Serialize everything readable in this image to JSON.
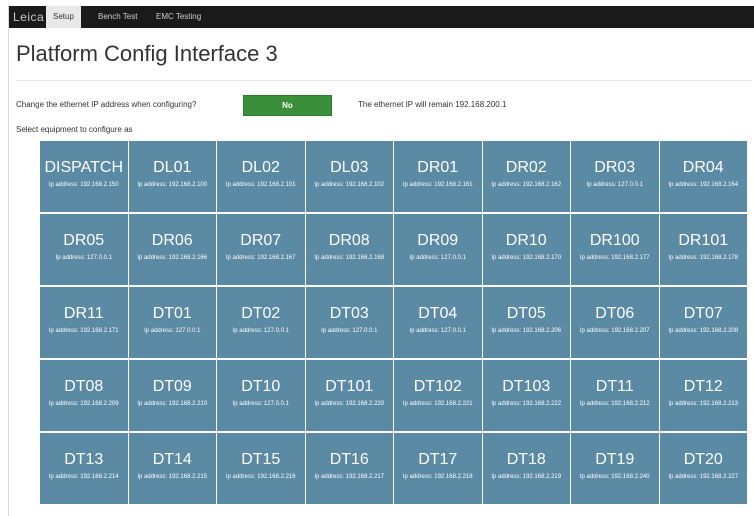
{
  "navbar": {
    "brand": "Leica",
    "tabs": [
      {
        "label": "Setup",
        "active": true
      },
      {
        "label": "Bench Test",
        "active": false
      },
      {
        "label": "EMC Testing",
        "active": false
      }
    ]
  },
  "page": {
    "title": "Platform Config Interface 3",
    "question": "Change the ethernet IP address when configuring?",
    "no_button_label": "No",
    "ip_note": "The ethernet IP will remain 192.168.200.1",
    "select_label": "Select equipment to configure as"
  },
  "colors": {
    "tile_bg": "#5b8aa4",
    "button_green": "#3a8f3a",
    "navbar_bg": "#1a1a1a"
  },
  "equipment": [
    {
      "name": "DISPATCH",
      "ip": "Ip address: 192.168.2.150"
    },
    {
      "name": "DL01",
      "ip": "Ip address: 192.168.2.100"
    },
    {
      "name": "DL02",
      "ip": "Ip address: 192.168.2.101"
    },
    {
      "name": "DL03",
      "ip": "Ip address: 192.168.2.102"
    },
    {
      "name": "DR01",
      "ip": "Ip address: 192.168.2.161"
    },
    {
      "name": "DR02",
      "ip": "Ip address: 192.168.2.162"
    },
    {
      "name": "DR03",
      "ip": "Ip address: 127.0.0.1"
    },
    {
      "name": "DR04",
      "ip": "Ip address: 192.168.2.164"
    },
    {
      "name": "DR05",
      "ip": "Ip address: 127.0.0.1"
    },
    {
      "name": "DR06",
      "ip": "Ip address: 192.168.2.166"
    },
    {
      "name": "DR07",
      "ip": "Ip address: 192.168.2.167"
    },
    {
      "name": "DR08",
      "ip": "Ip address: 192.168.2.168"
    },
    {
      "name": "DR09",
      "ip": "Ip address: 127.0.0.1"
    },
    {
      "name": "DR10",
      "ip": "Ip address: 192.168.2.170"
    },
    {
      "name": "DR100",
      "ip": "Ip address: 192.168.2.177"
    },
    {
      "name": "DR101",
      "ip": "Ip address: 192.168.2.178"
    },
    {
      "name": "DR11",
      "ip": "Ip address: 192.168.2.171"
    },
    {
      "name": "DT01",
      "ip": "Ip address: 127.0.0.1"
    },
    {
      "name": "DT02",
      "ip": "Ip address: 127.0.0.1"
    },
    {
      "name": "DT03",
      "ip": "Ip address: 127.0.0.1"
    },
    {
      "name": "DT04",
      "ip": "Ip address: 127.0.0.1"
    },
    {
      "name": "DT05",
      "ip": "Ip address: 192.168.2.206"
    },
    {
      "name": "DT06",
      "ip": "Ip address: 192.168.2.207"
    },
    {
      "name": "DT07",
      "ip": "Ip address: 192.168.2.208"
    },
    {
      "name": "DT08",
      "ip": "Ip address: 192.168.2.209"
    },
    {
      "name": "DT09",
      "ip": "Ip address: 192.168.2.210"
    },
    {
      "name": "DT10",
      "ip": "Ip address: 127.0.0.1"
    },
    {
      "name": "DT101",
      "ip": "Ip address: 192.168.2.220"
    },
    {
      "name": "DT102",
      "ip": "Ip address: 192.168.2.221"
    },
    {
      "name": "DT103",
      "ip": "Ip address: 192.168.2.222"
    },
    {
      "name": "DT11",
      "ip": "Ip address: 192.168.2.212"
    },
    {
      "name": "DT12",
      "ip": "Ip address: 192.168.2.213"
    },
    {
      "name": "DT13",
      "ip": "Ip address: 192.168.2.214"
    },
    {
      "name": "DT14",
      "ip": "Ip address: 192.168.2.215"
    },
    {
      "name": "DT15",
      "ip": "Ip address: 192.168.2.216"
    },
    {
      "name": "DT16",
      "ip": "Ip address: 192.168.2.217"
    },
    {
      "name": "DT17",
      "ip": "Ip address: 192.168.2.218"
    },
    {
      "name": "DT18",
      "ip": "Ip address: 192.168.2.219"
    },
    {
      "name": "DT19",
      "ip": "Ip address: 192.168.2.240"
    },
    {
      "name": "DT20",
      "ip": "Ip address: 192.168.2.227"
    }
  ]
}
